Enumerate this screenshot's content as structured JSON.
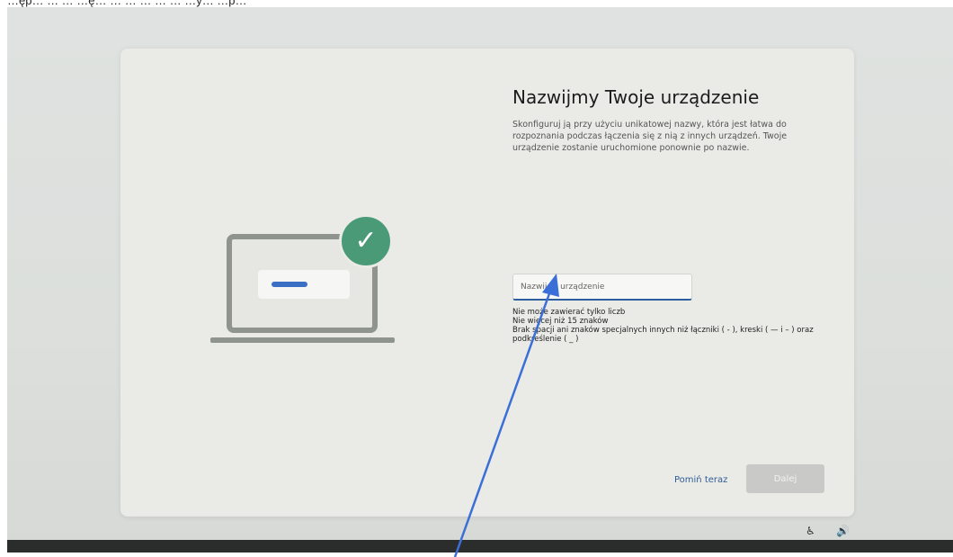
{
  "caption": "…ęp… … … …ę… … … … … … …y… …p…",
  "dialog": {
    "title": "Nazwijmy Twoje urządzenie",
    "description": "Skonfiguruj ją przy użyciu unikatowej nazwy, która jest łatwa do rozpoznania podczas łączenia się z nią z innych urządzeń. Twoje urządzenie zostanie uruchomione ponownie po nazwie.",
    "input": {
      "placeholder": "Nazwij to urządzenie",
      "value": ""
    },
    "rules": [
      "Nie może zawierać tylko liczb",
      "Nie więcej niż 15 znaków",
      "Brak spacji ani znaków specjalnych innych niż łączniki ( - ), kreski ( — i – ) oraz podkreślenie ( _ )"
    ],
    "skip_label": "Pomiń teraz",
    "next_label": "Dalej"
  },
  "illustration": {
    "check_icon": "check-icon",
    "check_glyph": "✓",
    "circle_color": "#4a9a78",
    "bar_color": "#3a6fc4"
  },
  "tray": {
    "accessibility_glyph": "♿",
    "volume_glyph": "🔊"
  },
  "colors": {
    "accent": "#2d5f9e",
    "annotation_arrow": "#3b6fd8"
  }
}
